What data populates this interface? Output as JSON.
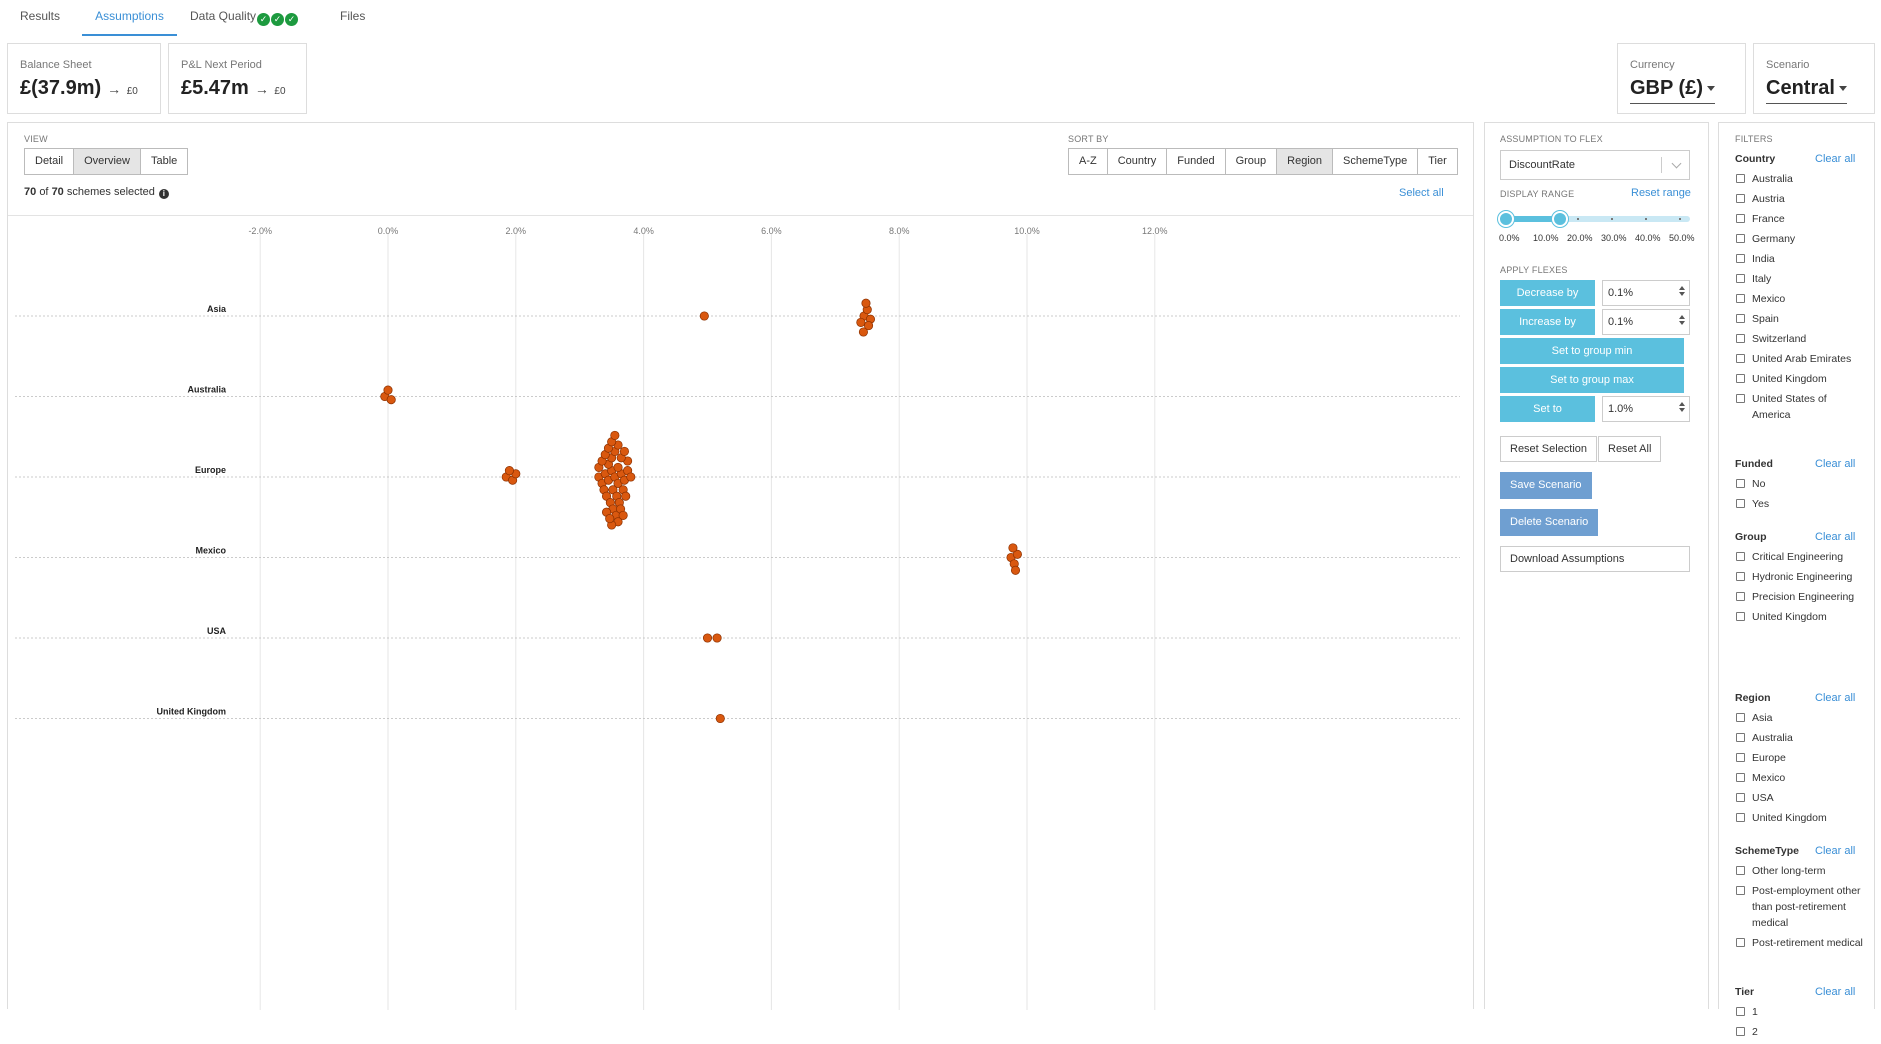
{
  "tabs": [
    {
      "label": "Results"
    },
    {
      "label": "Assumptions"
    },
    {
      "label": "Data Quality"
    },
    {
      "label": "Files"
    }
  ],
  "kpis": {
    "balance_sheet": {
      "label": "Balance Sheet",
      "value": "£(37.9m)",
      "delta": "£0"
    },
    "pnl": {
      "label": "P&L Next Period",
      "value": "£5.47m",
      "delta": "£0"
    }
  },
  "currency": {
    "label": "Currency",
    "value": "GBP (£)"
  },
  "scenario": {
    "label": "Scenario",
    "value": "Central"
  },
  "view": {
    "label": "VIEW",
    "options": [
      "Detail",
      "Overview",
      "Table"
    ],
    "selected": "Overview"
  },
  "sort": {
    "label": "SORT BY",
    "options": [
      "A-Z",
      "Country",
      "Funded",
      "Group",
      "Region",
      "SchemeType",
      "Tier"
    ],
    "selected": "Region"
  },
  "selection": {
    "selected": "70",
    "total": "70",
    "suffix": "schemes selected",
    "of": "of",
    "select_all": "Select all"
  },
  "chart_data": {
    "type": "scatter",
    "x_ticks": [
      "-2.0%",
      "0.0%",
      "2.0%",
      "4.0%",
      "6.0%",
      "8.0%",
      "10.0%",
      "12.0%"
    ],
    "xlim": [
      -6,
      13
    ],
    "categories": [
      "Asia",
      "Australia",
      "Europe",
      "Mexico",
      "USA",
      "United Kingdom"
    ],
    "marker_color": "#d9580f",
    "series": [
      {
        "category": "Asia",
        "values": [
          4.95,
          7.45,
          7.55,
          7.5,
          7.4,
          7.52,
          7.48,
          7.44
        ]
      },
      {
        "category": "Australia",
        "values": [
          -0.05,
          0.05,
          0.0
        ]
      },
      {
        "category": "Europe",
        "values": [
          1.85,
          1.95,
          2.0,
          1.9,
          3.3,
          3.35,
          3.4,
          3.45,
          3.5,
          3.55,
          3.6,
          3.65,
          3.7,
          3.75,
          3.8,
          3.3,
          3.38,
          3.45,
          3.52,
          3.6,
          3.68,
          3.75,
          3.35,
          3.42,
          3.5,
          3.58,
          3.65,
          3.72,
          3.4,
          3.48,
          3.55,
          3.62,
          3.7,
          3.45,
          3.52,
          3.6,
          3.5,
          3.57,
          3.64,
          3.42,
          3.55,
          3.68,
          3.6,
          3.5,
          3.47
        ]
      },
      {
        "category": "Mexico",
        "values": [
          9.75,
          9.8,
          9.85,
          9.78,
          9.82
        ]
      },
      {
        "category": "USA",
        "values": [
          5.0,
          5.15
        ]
      },
      {
        "category": "United Kingdom",
        "values": [
          5.2
        ]
      }
    ]
  },
  "flex": {
    "assumption_label": "ASSUMPTION TO FLEX",
    "assumption_value": "DiscountRate",
    "range_label": "DISPLAY RANGE",
    "reset_range": "Reset range",
    "range_ticks": [
      "0.0%",
      "10.0%",
      "20.0%",
      "30.0%",
      "40.0%",
      "50.0%"
    ],
    "range_min": 0,
    "range_max": 10,
    "apply_label": "APPLY FLEXES",
    "decrease_label": "Decrease by",
    "decrease_value": "0.1%",
    "increase_label": "Increase by",
    "increase_value": "0.1%",
    "group_min_label": "Set to group min",
    "group_max_label": "Set to group max",
    "set_to_label": "Set to",
    "set_to_value": "1.0%",
    "reset_selection": "Reset Selection",
    "reset_all": "Reset All",
    "save_scenario": "Save Scenario",
    "delete_scenario": "Delete Scenario",
    "download": "Download Assumptions"
  },
  "filters": {
    "title": "FILTERS",
    "clear_label": "Clear all",
    "groups": [
      {
        "name": "Country",
        "items": [
          "Australia",
          "Austria",
          "France",
          "Germany",
          "India",
          "Italy",
          "Mexico",
          "Spain",
          "Switzerland",
          "United Arab Emirates",
          "United Kingdom",
          "United States of America"
        ]
      },
      {
        "name": "Funded",
        "items": [
          "No",
          "Yes"
        ]
      },
      {
        "name": "Group",
        "items": [
          "Critical Engineering",
          "Hydronic Engineering",
          "Precision Engineering",
          "United Kingdom"
        ]
      },
      {
        "name": "Region",
        "items": [
          "Asia",
          "Australia",
          "Europe",
          "Mexico",
          "USA",
          "United Kingdom"
        ]
      },
      {
        "name": "SchemeType",
        "items": [
          "Other long-term",
          "Post-employment other than post-retirement medical",
          "Post-retirement medical"
        ]
      },
      {
        "name": "Tier",
        "items": [
          "1",
          "2"
        ]
      }
    ]
  }
}
